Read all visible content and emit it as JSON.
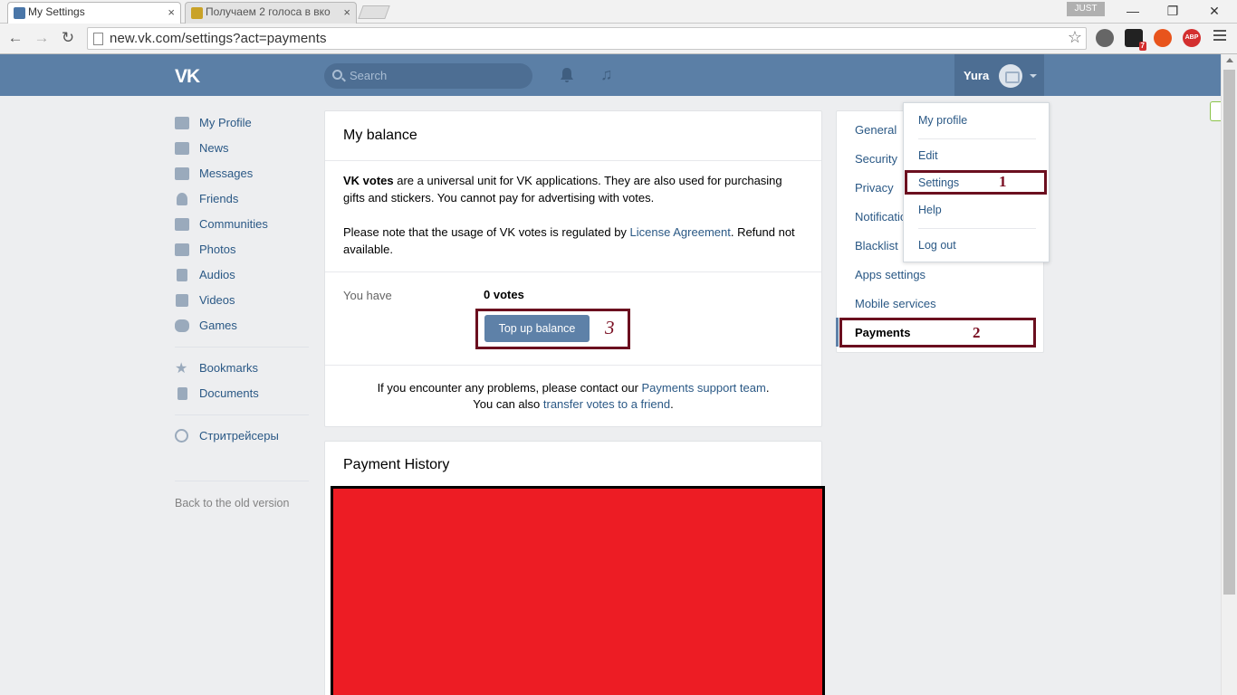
{
  "browser": {
    "tabs": [
      {
        "title": "My Settings",
        "close": "×",
        "favicon_color": "#4a76a8"
      },
      {
        "title": "Получаем 2 голоса в вко",
        "close": "×",
        "favicon_color": "#c9a227"
      }
    ],
    "profile_badge": "JUST",
    "window_buttons": {
      "minimize": "—",
      "restore": "❐",
      "close": "✕"
    },
    "nav": {
      "back": "←",
      "forward": "→",
      "reload": "↻"
    },
    "url": "new.vk.com/settings?act=payments",
    "star": "☆",
    "extensions": [
      {
        "name": "globe-icon",
        "color": "#666666",
        "text": ""
      },
      {
        "name": "ghostery-icon",
        "color": "#222222",
        "text": "7"
      },
      {
        "name": "fire-icon",
        "color": "#e8541c",
        "text": ""
      },
      {
        "name": "adblock-plus-icon",
        "color": "#d32f2f",
        "text": "ABP"
      }
    ]
  },
  "header": {
    "logo": "VK",
    "search_placeholder": "Search",
    "bell": "🔔",
    "music": "♫",
    "user_name": "Yura"
  },
  "left_menu": {
    "items": [
      "My Profile",
      "News",
      "Messages",
      "Friends",
      "Communities",
      "Photos",
      "Audios",
      "Videos",
      "Games"
    ],
    "items2": [
      "Bookmarks",
      "Documents"
    ],
    "items3": [
      "Стритрейсеры"
    ],
    "old_version": "Back to the old version"
  },
  "balance": {
    "title": "My balance",
    "p1_bold": "VK votes",
    "p1_rest": " are a universal unit for VK applications. They are also used for purchasing gifts and stickers. You cannot pay for advertising with votes.",
    "p2_pre": "Please note that the usage of VK votes is regulated by ",
    "p2_link": "License Agreement",
    "p2_post": ". Refund not available.",
    "you_have_label": "You have",
    "votes": "0 votes",
    "top_up": "Top up balance",
    "footer1_pre": "If you encounter any problems, please contact our ",
    "footer1_link": "Payments support team",
    "footer1_post": ".",
    "footer2_pre": "You can also ",
    "footer2_link": "transfer votes to a friend",
    "footer2_post": "."
  },
  "history": {
    "title": "Payment History"
  },
  "settings_menu": {
    "items": [
      "General",
      "Security",
      "Privacy",
      "Notifications",
      "Blacklist",
      "Apps settings",
      "Mobile services",
      "Payments"
    ],
    "active": "Payments"
  },
  "dropdown": {
    "items": [
      "My profile",
      "Edit",
      "Settings",
      "Help",
      "Log out"
    ]
  },
  "annotations": {
    "mark1": "1",
    "mark2": "2",
    "mark3": "3",
    "color": "#6b0f1f",
    "redact_color": "#ed1c24"
  }
}
